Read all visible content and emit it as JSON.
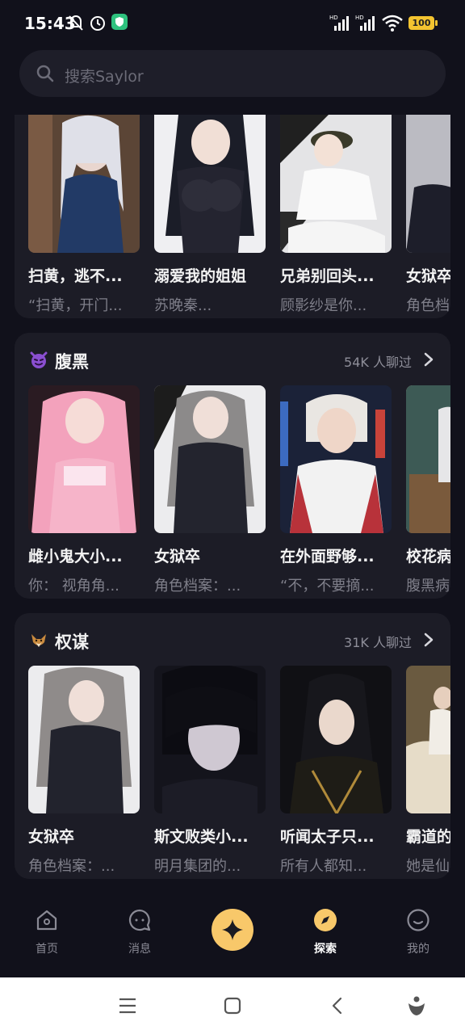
{
  "status_bar": {
    "time": "15:43",
    "battery": "100"
  },
  "search": {
    "placeholder": "搜索Saylor"
  },
  "colors": {
    "background": "#11111b",
    "card": "#1c1c26",
    "accent": "#f8c86a"
  },
  "top_section": {
    "items": [
      {
        "name": "扫黄，逃不...",
        "desc": "“扫黄，开门..."
      },
      {
        "name": "溺爱我的姐姐",
        "desc": "苏晚秦..."
      },
      {
        "name": "兄弟别回头...",
        "desc": "顾影纱是你..."
      },
      {
        "name": "女狱卒",
        "desc": "角色档"
      }
    ]
  },
  "sections": [
    {
      "title": "腹黑",
      "icon": "devil-emoji-icon",
      "count": "54K 人聊过",
      "items": [
        {
          "name": "雌小鬼大小...",
          "desc": "你：  视角角..."
        },
        {
          "name": "女狱卒",
          "desc": "角色档案：..."
        },
        {
          "name": "在外面野够...",
          "desc": "“不，不要摘..."
        },
        {
          "name": "校花病",
          "desc": "腹黑病"
        }
      ]
    },
    {
      "title": "权谋",
      "icon": "fox-emoji-icon",
      "count": "31K 人聊过",
      "items": [
        {
          "name": "女狱卒",
          "desc": "角色档案：..."
        },
        {
          "name": "斯文败类小...",
          "desc": "明月集团的..."
        },
        {
          "name": "听闻太子只...",
          "desc": "所有人都知..."
        },
        {
          "name": "霸道的",
          "desc": "她是仙"
        }
      ]
    }
  ],
  "bottom_nav": {
    "home": "首页",
    "messages": "消息",
    "explore": "探索",
    "mine": "我的"
  }
}
